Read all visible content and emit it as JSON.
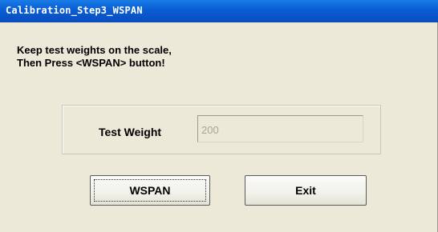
{
  "window": {
    "title": "Calibration_Step3_WSPAN"
  },
  "message": {
    "line1": "Keep test weights on the scale,",
    "line2": "Then Press <WSPAN> button!"
  },
  "test_weight": {
    "label": "Test Weight",
    "value": "200"
  },
  "buttons": {
    "wspan_label": "WSPAN",
    "exit_label": "Exit"
  }
}
